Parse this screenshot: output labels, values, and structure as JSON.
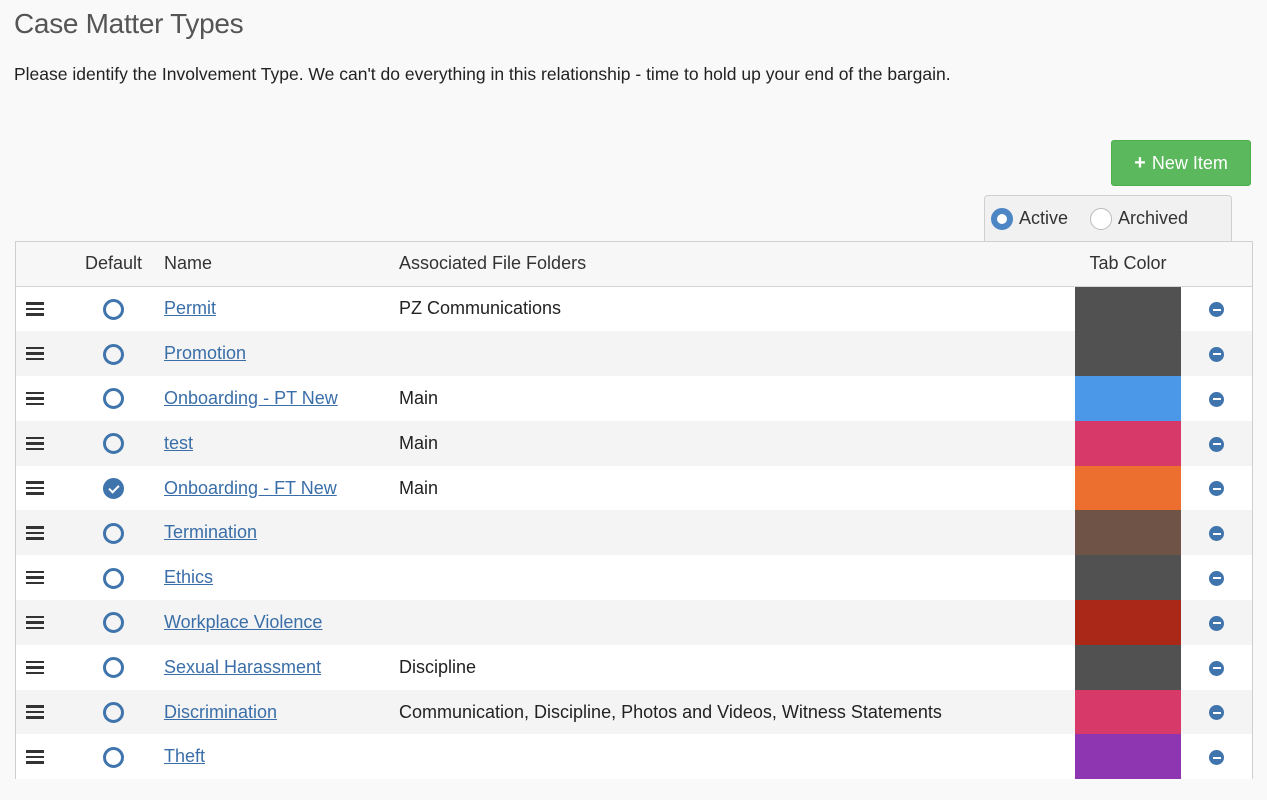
{
  "page": {
    "title": "Case Matter Types",
    "instructions": "Please identify the Involvement Type. We can't do everything in this relationship - time to hold up your end of the bargain."
  },
  "toolbar": {
    "new_item_icon": "+",
    "new_item_label": "New Item",
    "new_item_color": "#5cb85c"
  },
  "filter": {
    "options": [
      {
        "label": "Active",
        "selected": true
      },
      {
        "label": "Archived",
        "selected": false
      }
    ]
  },
  "table": {
    "headers": {
      "default": "Default",
      "name": "Name",
      "folders": "Associated File Folders",
      "tab_color": "Tab Color"
    },
    "rows": [
      {
        "name": "Permit",
        "folders": "PZ Communications",
        "default": false,
        "color": "#515151"
      },
      {
        "name": "Promotion",
        "folders": "",
        "default": false,
        "color": "#515151"
      },
      {
        "name": "Onboarding - PT New",
        "folders": "Main",
        "default": false,
        "color": "#4b97e8"
      },
      {
        "name": "test",
        "folders": "Main",
        "default": false,
        "color": "#d73a68"
      },
      {
        "name": "Onboarding - FT New",
        "folders": "Main",
        "default": true,
        "color": "#ec6f30"
      },
      {
        "name": "Termination",
        "folders": "",
        "default": false,
        "color": "#6e5346"
      },
      {
        "name": "Ethics",
        "folders": "",
        "default": false,
        "color": "#515151"
      },
      {
        "name": "Workplace Violence",
        "folders": "",
        "default": false,
        "color": "#aa2818"
      },
      {
        "name": "Sexual Harassment",
        "folders": "Discipline",
        "default": false,
        "color": "#515151"
      },
      {
        "name": "Discrimination",
        "folders": "Communication, Discipline, Photos and Videos, Witness Statements",
        "default": false,
        "color": "#d73a68"
      },
      {
        "name": "Theft",
        "folders": "",
        "default": false,
        "color": "#8e36b1"
      }
    ]
  },
  "icons": {
    "drag": "drag-handle-icon",
    "default_unchecked": "radio-empty-icon",
    "default_checked": "check-circle-icon",
    "remove": "minus-circle-icon"
  },
  "colors": {
    "accent": "#3f74ad",
    "link": "#3a6ea8"
  }
}
